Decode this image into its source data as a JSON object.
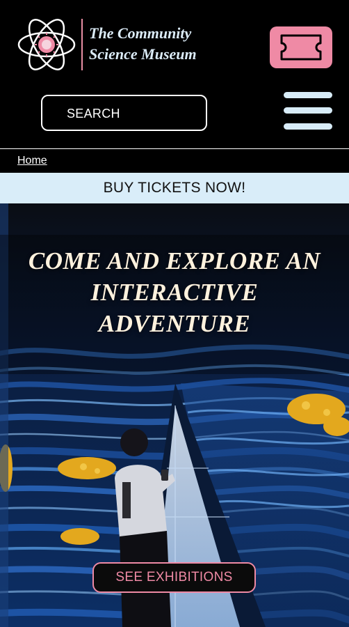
{
  "header": {
    "brand_line1": "The Community",
    "brand_line2": "Science Museum",
    "search_label": "SEARCH",
    "logo_icon": "atom-icon",
    "ticket_icon": "ticket-icon",
    "menu_icon": "hamburger-menu-icon"
  },
  "breadcrumb": {
    "home_label": "Home"
  },
  "banner": {
    "label": "BUY TICKETS NOW!"
  },
  "hero": {
    "title_line1": "COME AND EXPLORE AN",
    "title_line2": "INTERACTIVE",
    "title_line3": "ADVENTURE",
    "cta_label": "SEE EXHIBITIONS"
  },
  "colors": {
    "accent_pink": "#ef8aa5",
    "light_blue": "#d9edf9",
    "background": "#000000",
    "title_cream": "#fff2de"
  }
}
